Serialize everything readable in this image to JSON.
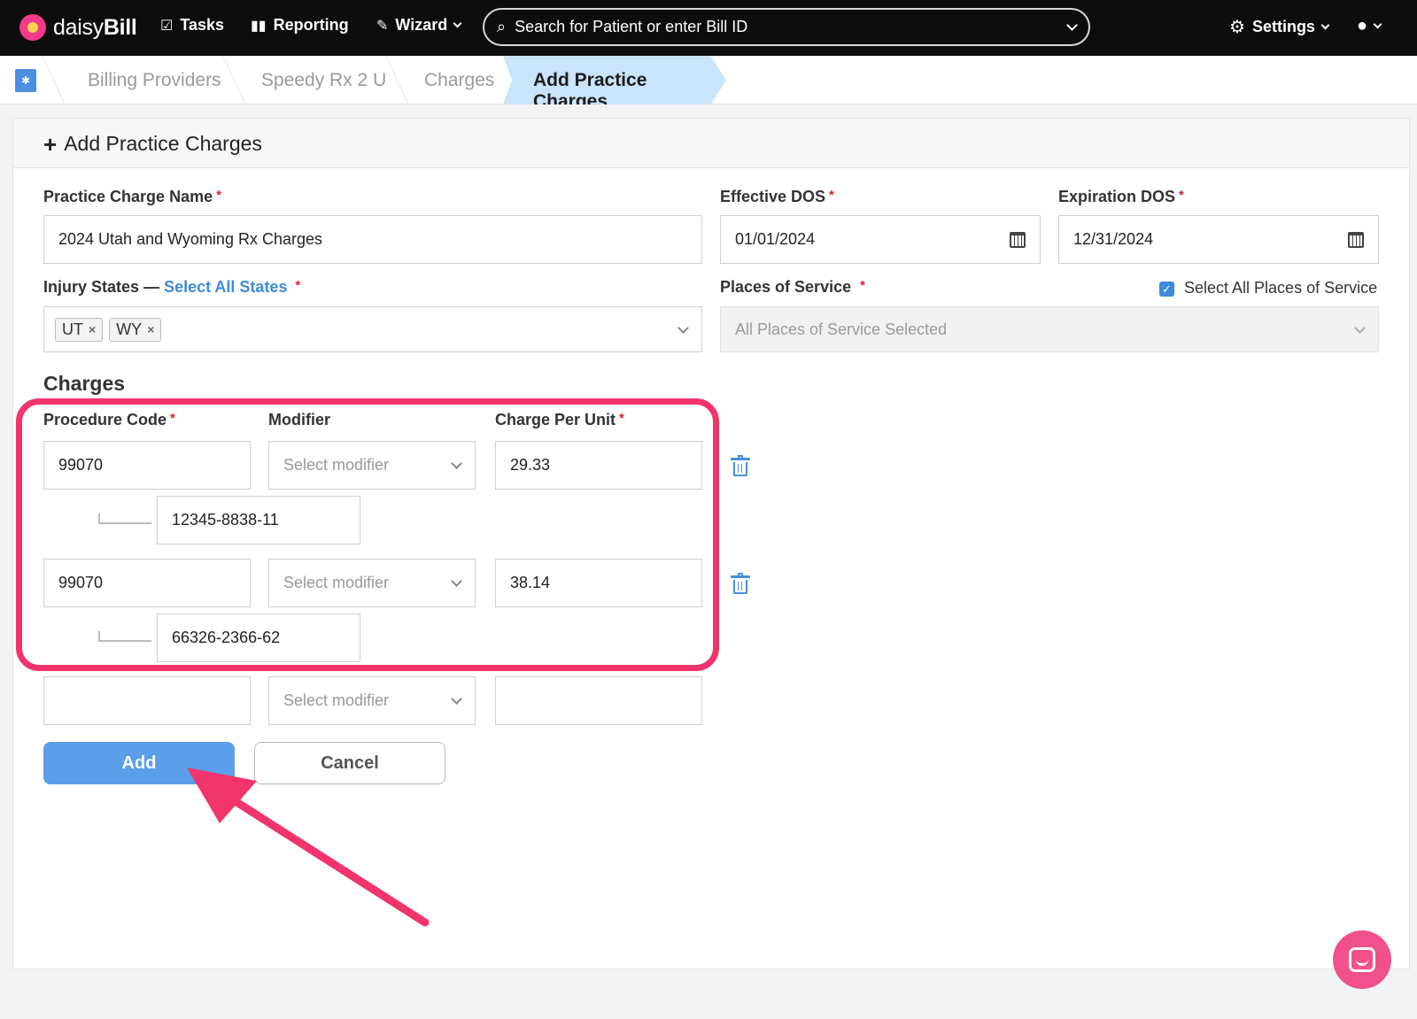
{
  "topbar": {
    "brand_light": "daisy",
    "brand_bold": "Bill",
    "tasks": "Tasks",
    "reporting": "Reporting",
    "wizard": "Wizard",
    "search_placeholder": "Search for Patient or enter Bill ID",
    "settings": "Settings"
  },
  "breadcrumb": {
    "items": [
      "Billing Providers",
      "Speedy Rx 2 U",
      "Charges"
    ],
    "active": "Add Practice Charges"
  },
  "form": {
    "title": "Add Practice Charges",
    "practice_charge_name_label": "Practice Charge Name",
    "practice_charge_name_value": "2024 Utah and Wyoming Rx Charges",
    "effective_dos_label": "Effective DOS",
    "effective_dos_value": "01/01/2024",
    "expiration_dos_label": "Expiration DOS",
    "expiration_dos_value": "12/31/2024",
    "injury_states_label": "Injury States —",
    "select_all_states": "Select All States",
    "injury_states": [
      "UT",
      "WY"
    ],
    "places_of_service_label": "Places of Service",
    "select_all_places_label": "Select All Places of Service",
    "select_all_places_checked": true,
    "places_of_service_value": "All Places of Service Selected",
    "required_mark": "*",
    "tag_remove": "×"
  },
  "charges": {
    "section_title": "Charges",
    "procedure_code_label": "Procedure Code",
    "modifier_label": "Modifier",
    "charge_per_unit_label": "Charge Per Unit",
    "modifier_placeholder": "Select modifier",
    "rows": [
      {
        "procedure_code": "99070",
        "charge": "29.33",
        "ndc": "12345-8838-11"
      },
      {
        "procedure_code": "99070",
        "charge": "38.14",
        "ndc": "66326-2366-62"
      },
      {
        "procedure_code": "",
        "charge": ""
      }
    ]
  },
  "buttons": {
    "add": "Add",
    "cancel": "Cancel"
  },
  "colors": {
    "accent": "#5b9ee9",
    "highlight": "#f2346c",
    "breadcrumb_active": "#c9e4fb"
  }
}
